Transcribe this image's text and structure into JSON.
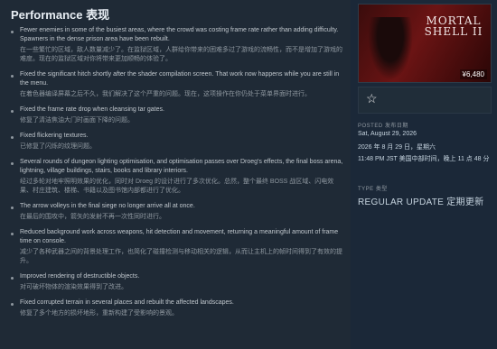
{
  "main": {
    "title": "Performance 表现",
    "notes": [
      {
        "en": "Fewer enemies in some of the busiest areas, where the crowd was costing frame rate rather than adding difficulty. Spawners in the dense prison area have been rebuilt.",
        "zh": "在一些繁忙的区域，敌人数量减少了。在监狱区域，人群给你带来的困难多过了游戏的流畅性，而不是增加了游戏的难度。现在的监狱区域对你将带来更加顺畅的体验了。"
      },
      {
        "en": "Fixed the significant hitch shortly after the shader compilation screen. That work now happens while you are still in the menu.",
        "zh": "在着色器编译屏幕之后不久，我们解决了这个严重的问题。现在，这项操作在你仍处于菜单界面时进行。"
      },
      {
        "en": "Fixed the frame rate drop when cleansing tar gates.",
        "zh": "修复了清洁焦油大门时画面下降的问题。"
      },
      {
        "en": "Fixed flickering textures.",
        "zh": "已修复了闪烁的纹理问题。"
      },
      {
        "en": "Several rounds of dungeon lighting optimisation, and optimisation passes over Droeg's effects, the final boss arena, lightning, village buildings, stairs, books and library interiors.",
        "zh": "经过多轮对地牢照明效果的优化，同时对 Droeg 的设计进行了多次优化。总然，整个最终 BOSS 战区域、闪电效果、村庄建筑、楼梯、书籍以及图书馆内部都进行了优化。"
      },
      {
        "en": "The arrow volleys in the final siege no longer arrive all at once.",
        "zh": "在最后的围攻中，箭矢的发射不再一次性同时进行。"
      },
      {
        "en": "Reduced background work across weapons, hit detection and movement, returning a meaningful amount of frame time on console.",
        "zh": "减少了各种武器之间的背景处理工作，也简化了碰撞检测与移动相关的逻辑，从而让主机上的帧时间得到了有效的提升。"
      },
      {
        "en": "Improved rendering of destructible objects.",
        "zh": "对可破坏物体的渲染效果得到了改进。"
      },
      {
        "en": "Fixed corrupted terrain in several places and rebuilt the affected landscapes.",
        "zh": "修复了多个地方的损坏地形，重新构建了受影响的景观。"
      }
    ]
  },
  "side": {
    "game_logo": "MORTAL SHELL II",
    "price": "¥6,480",
    "wishlist_icon": "star-icon",
    "posted_label": "POSTED 发布日期",
    "posted_date_en": "Sat, August 29, 2026",
    "posted_date_zh": "2026 年 8 月 29 日，星期六",
    "posted_time": "11:48 PM JST 美国中部时间，晚上 11 点 48 分",
    "type_label": "TYPE 类型",
    "type_value": "REGULAR UPDATE 定期更新"
  }
}
